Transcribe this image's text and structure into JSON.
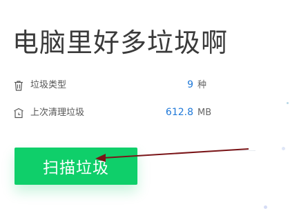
{
  "headline": "电脑里好多垃圾啊",
  "stats": [
    {
      "icon": "trash-icon",
      "label": "垃圾类型",
      "value": "9",
      "unit": "种"
    },
    {
      "icon": "history-icon",
      "label": "上次清理垃圾",
      "value": "612.8",
      "unit": "MB"
    }
  ],
  "scan_button": {
    "label": "扫描垃圾"
  },
  "colors": {
    "accent_green": "#0fcf6a",
    "value_blue": "#1e78d8",
    "headline_text": "#3a3a3a",
    "annotation_arrow": "#7a1518"
  }
}
